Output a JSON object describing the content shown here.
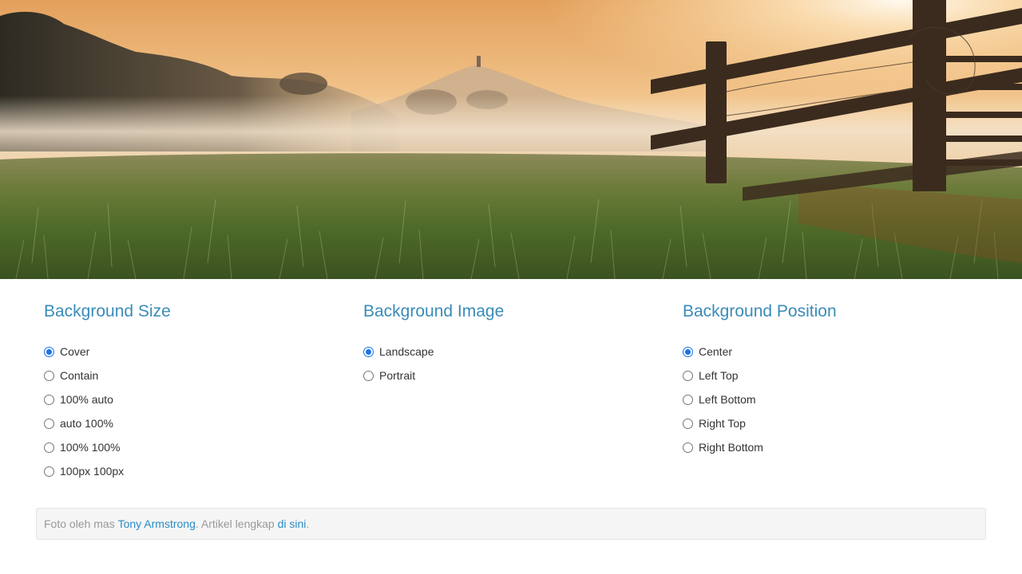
{
  "hero": {
    "image_name": "misty-meadow-sunrise-with-fence",
    "colors": {
      "sky_top": "#e6a462",
      "sky_glow": "#fde2b6",
      "grass": "#4f6a2a",
      "fence": "#3a2a1d"
    }
  },
  "sections": [
    {
      "title": "Background Size",
      "options": [
        {
          "label": "Cover",
          "checked": true
        },
        {
          "label": "Contain",
          "checked": false
        },
        {
          "label": "100% auto",
          "checked": false
        },
        {
          "label": "auto 100%",
          "checked": false
        },
        {
          "label": "100% 100%",
          "checked": false
        },
        {
          "label": "100px 100px",
          "checked": false
        }
      ]
    },
    {
      "title": "Background Image",
      "options": [
        {
          "label": "Landscape",
          "checked": true
        },
        {
          "label": "Portrait",
          "checked": false
        }
      ]
    },
    {
      "title": "Background Position",
      "options": [
        {
          "label": "Center",
          "checked": true
        },
        {
          "label": "Left Top",
          "checked": false
        },
        {
          "label": "Left Bottom",
          "checked": false
        },
        {
          "label": "Right Top",
          "checked": false
        },
        {
          "label": "Right Bottom",
          "checked": false
        }
      ]
    }
  ],
  "footer": {
    "prefix": "Foto oleh mas ",
    "author_link": "Tony Armstrong",
    "middle": ". Artikel lengkap ",
    "article_link": "di sini",
    "suffix": "."
  },
  "colors": {
    "heading": "#3b8bb8",
    "link": "#2a8cc7",
    "muted": "#999999",
    "radio_accent": "#1a73e8"
  }
}
